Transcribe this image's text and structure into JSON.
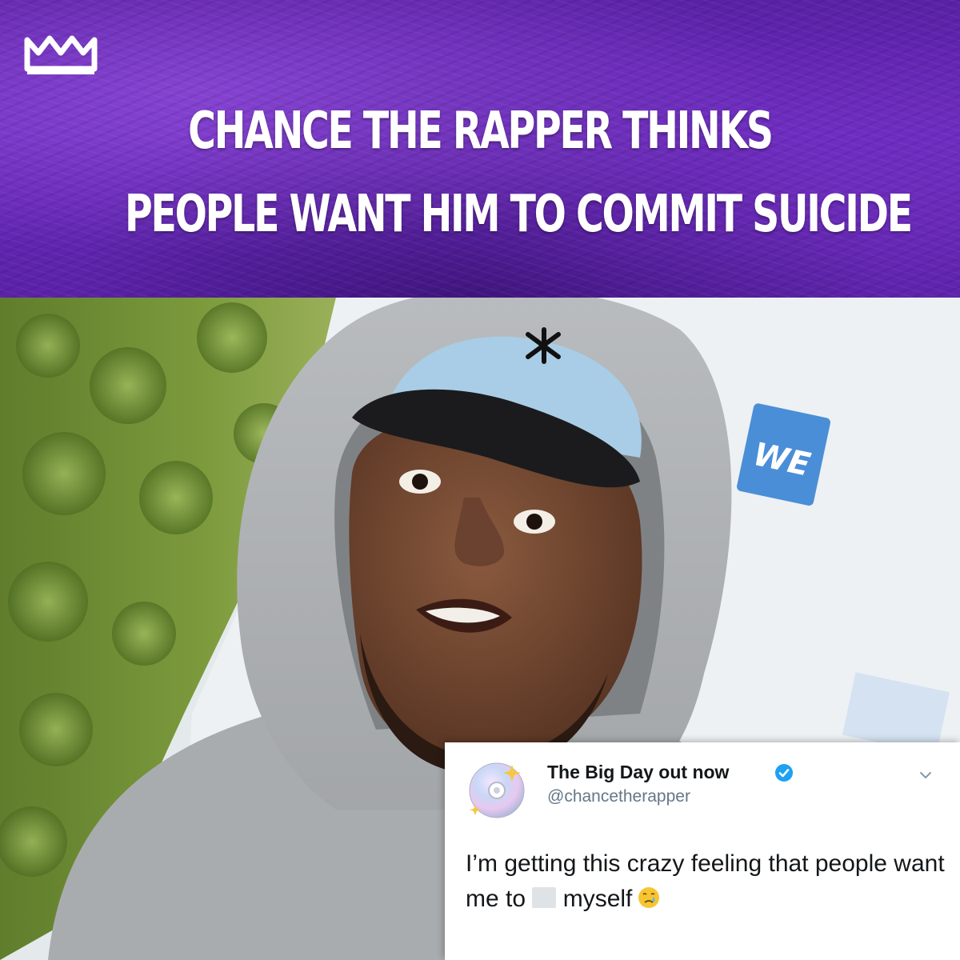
{
  "banner": {
    "brand_logo": "MM crown logo",
    "headline_line1": "CHANCE THE RAPPER THINKS",
    "headline_line2": "PEOPLE WANT HIM TO COMMIT SUICIDE",
    "bg_color": "#6a2bbd"
  },
  "photo": {
    "backdrop_logo_text": "WE",
    "backdrop_logo_color": "#4a8ed8"
  },
  "tweet": {
    "display_name": "The Big Day out now",
    "handle": "@chancetherapper",
    "text_part1": "I’m getting this crazy feeling that people want me to ",
    "text_part2": " myself",
    "verified_icon": "verified-badge-icon",
    "emoji_icon": "crying-face-icon"
  }
}
